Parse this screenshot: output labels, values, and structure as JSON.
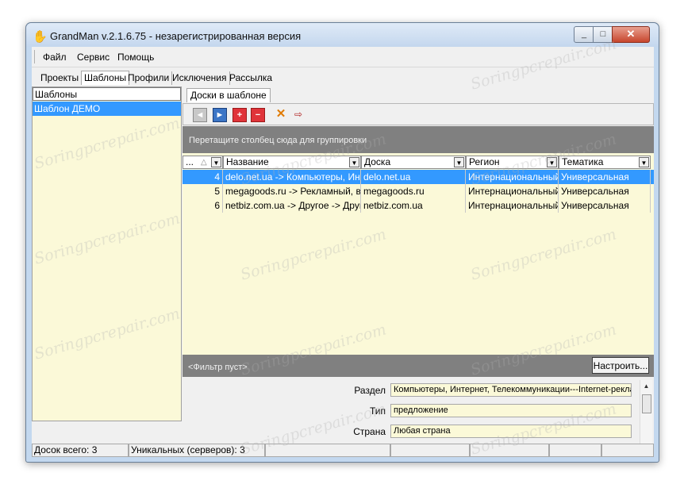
{
  "window": {
    "title": "GrandMan v.2.1.6.75 -  незарегистрированная версия",
    "icon": "app-hand-icon",
    "controls": {
      "minimize": "_",
      "maximize": "□",
      "close": "✕"
    }
  },
  "menu": {
    "items": [
      "Файл",
      "Сервис",
      "Помощь"
    ]
  },
  "tabs": {
    "items": [
      "Проекты",
      "Шаблоны",
      "Профили",
      "Исключения",
      "Рассылка"
    ],
    "active": "Шаблоны"
  },
  "left_panel": {
    "header": "Шаблоны",
    "items": [
      "Шаблон ДЕМО"
    ],
    "selected": "Шаблон ДЕМО",
    "toolbar": {
      "first": "◄",
      "last": "►",
      "add": "+",
      "remove": "−",
      "apply": "✓",
      "cancel": "✕"
    }
  },
  "right_panel": {
    "subtab": "Доски в шаблоне",
    "toolbar": {
      "first": "◄",
      "last": "►",
      "add": "+",
      "remove": "−",
      "delete": "✕",
      "export": "⇨"
    },
    "group_hint": "Перетащите столбец сюда для группировки",
    "columns": [
      "...",
      "Название",
      "Доска",
      "Регион",
      "Тематика"
    ],
    "sort_indicator": "△",
    "rows": [
      {
        "num": "4",
        "name": "delo.net.ua -> Компьютеры, Интер",
        "board": "delo.net.ua",
        "region": "Интернациональный",
        "theme": "Универсальная"
      },
      {
        "num": "5",
        "name": "megagoods.ru -> Рекламный, выст",
        "board": "megagoods.ru",
        "region": "Интернациональный",
        "theme": "Универсальная"
      },
      {
        "num": "6",
        "name": "netbiz.com.ua -> Другое -> Другое",
        "board": "netbiz.com.ua",
        "region": "Интернациональный",
        "theme": "Универсальная"
      }
    ],
    "filter_text": "<Фильтр пуст>",
    "configure_button": "Настроить...",
    "details": [
      {
        "label": "Раздел",
        "value": "Компьютеры, Интернет, Телекоммуникации---Internet-рекла"
      },
      {
        "label": "Тип",
        "value": "предложение"
      },
      {
        "label": "Страна",
        "value": "Любая страна"
      }
    ]
  },
  "statusbar": {
    "total": "Досок всего: 3",
    "unique": "Уникальных (серверов): 3"
  },
  "watermark": "Soringpcrepair.com",
  "colors": {
    "selection": "#3399ff",
    "panel_bg": "#fbf9d8",
    "band_gray": "#808080",
    "frame": "#c3d8ef"
  }
}
